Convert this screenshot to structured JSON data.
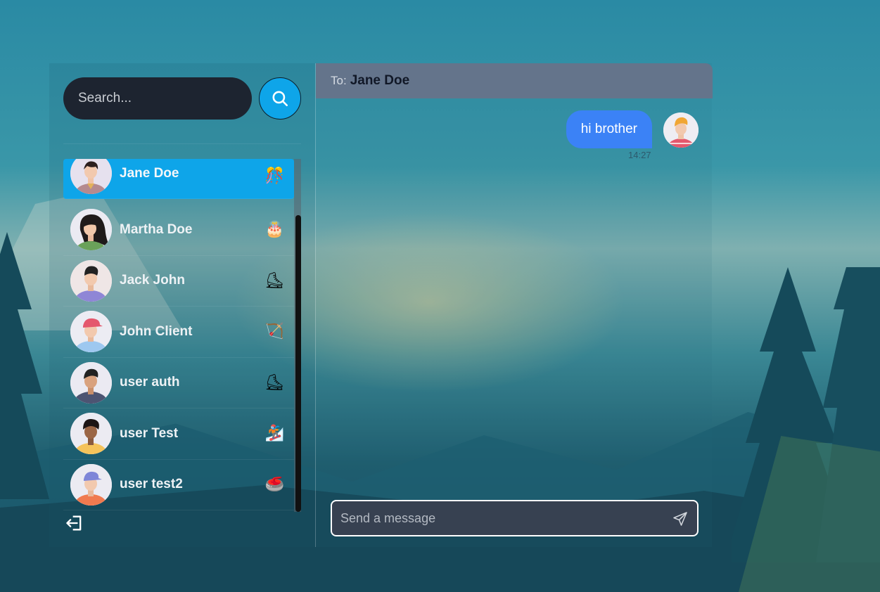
{
  "search": {
    "placeholder": "Search..."
  },
  "conversations": [
    {
      "name": "Jane Doe",
      "emoji": "🎊",
      "selected": true
    },
    {
      "name": "Martha Doe",
      "emoji": "🎂",
      "selected": false
    },
    {
      "name": "Jack John",
      "emoji": "⛸",
      "selected": false
    },
    {
      "name": "John Client",
      "emoji": "🏹",
      "selected": false
    },
    {
      "name": "user auth",
      "emoji": "⛸",
      "selected": false
    },
    {
      "name": "user Test",
      "emoji": "🏂",
      "selected": false
    },
    {
      "name": "user test2",
      "emoji": "🥌",
      "selected": false
    }
  ],
  "chat": {
    "to_label": "To:",
    "recipient": "Jane Doe",
    "messages": [
      {
        "text": "hi brother",
        "time": "14:27",
        "from_me": true
      }
    ],
    "composer_placeholder": "Send a message"
  },
  "icons": {
    "search": "search-icon",
    "logout": "logout-icon",
    "send": "send-icon"
  },
  "colors": {
    "selected": "#0ea5e9",
    "bubble": "#3b82f6",
    "header": "#64748b",
    "search_bg": "#1d2430"
  }
}
